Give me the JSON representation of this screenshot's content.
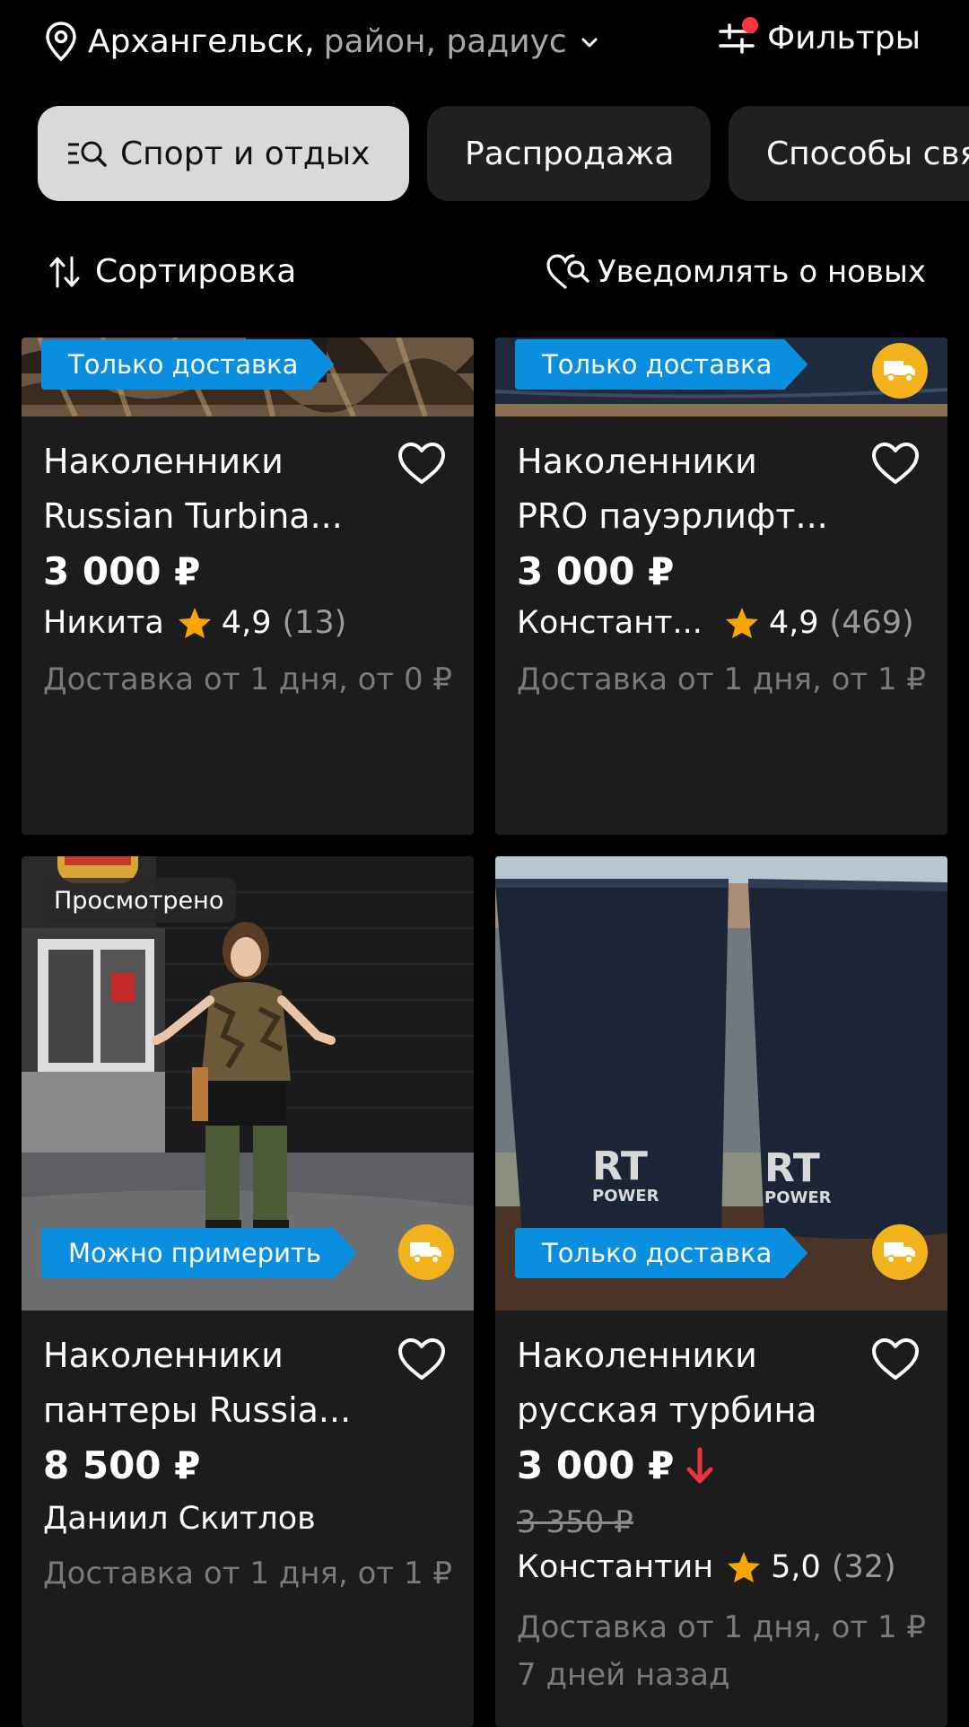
{
  "location": {
    "city": "Архангельск,",
    "detail": "район, радиус"
  },
  "filters": {
    "label": "Фильтры"
  },
  "chips": [
    {
      "label": "Спорт и отдых",
      "active": true
    },
    {
      "label": "Распродажа",
      "active": false
    },
    {
      "label": "Способы свя",
      "active": false
    }
  ],
  "sort": {
    "label": "Сортировка"
  },
  "notify": {
    "label": "Уведомлять о новых"
  },
  "listings": [
    {
      "badge": "Только доставка",
      "title_line1": "Наколенники",
      "title_line2": "Russian Turbina...",
      "price": "3 000 ₽",
      "seller": "Никита",
      "rating": "4,9",
      "reviews": "(13)",
      "delivery": "Доставка от 1 дня, от 0 ₽"
    },
    {
      "badge": "Только доставка",
      "title_line1": "Наколенники",
      "title_line2": "PRO пауэрлифт...",
      "price": "3 000 ₽",
      "seller": "Констант...",
      "rating": "4,9",
      "reviews": "(469)",
      "delivery": "Доставка от 1 дня, от 1 ₽"
    },
    {
      "viewed": "Просмотрено",
      "badge": "Можно примерить",
      "title_line1": "Наколенники",
      "title_line2": "пантеры Russia...",
      "price": "8 500 ₽",
      "seller": "Даниил Скитлов",
      "delivery": "Доставка от 1 дня, от 1 ₽"
    },
    {
      "badge": "Только доставка",
      "title_line1": "Наколенники",
      "title_line2": "русская турбина",
      "price": "3 000 ₽",
      "old_price": "3 350 ₽",
      "seller": "Константин",
      "rating": "5,0",
      "reviews": "(32)",
      "delivery": "Доставка от 1 дня, от 1 ₽",
      "posted": "7 дней назад"
    }
  ],
  "colors": {
    "background": "#000000",
    "card": "#1c1c1c",
    "ribbon": "#0a8fe0",
    "truck_badge": "#f2b21b",
    "star": "#f7a600",
    "price_drop": "#e8353f",
    "notification_dot": "#ff3340"
  },
  "icons": [
    "location-pin-icon",
    "chevron-down-icon",
    "filters-icon",
    "category-search-icon",
    "sort-icon",
    "notify-heart-search-icon",
    "heart-icon",
    "star-icon",
    "truck-icon",
    "arrow-down-icon"
  ]
}
